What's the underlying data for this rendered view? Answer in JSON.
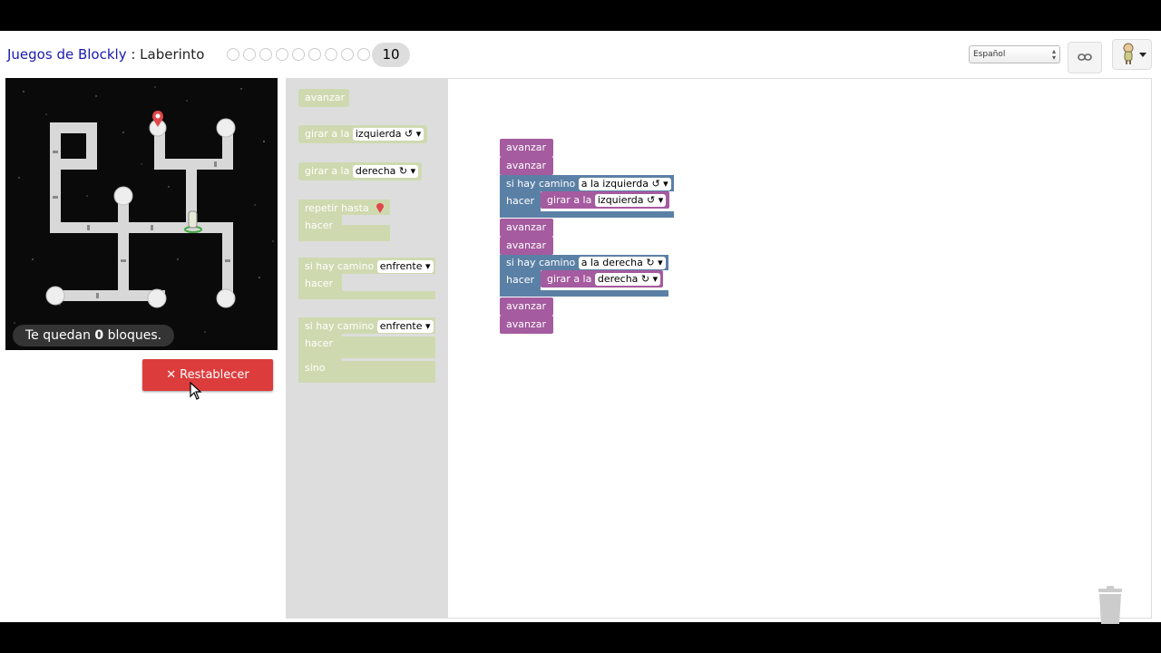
{
  "header": {
    "app_title": "Juegos de Blockly",
    "separator": " : ",
    "game_title": "Laberinto",
    "level_dots": 9,
    "current_level": "10",
    "language": "Español"
  },
  "maze": {
    "remaining_text_pre": "Te quedan ",
    "remaining_count": "0",
    "remaining_text_post": " bloques."
  },
  "reset_button": {
    "icon": "✕",
    "label": "Restablecer"
  },
  "toolbox": {
    "move_forward": "avanzar",
    "turn_left_label": "girar a la",
    "turn_left_value": "izquierda ↺ ▾",
    "turn_right_label": "girar a la",
    "turn_right_value": "derecha ↻ ▾",
    "repeat_label": "repetir hasta",
    "repeat_do": "hacer",
    "if_label": "si hay camino",
    "if_value": "enfrente ▾",
    "if_do": "hacer",
    "ifelse_label": "si hay camino",
    "ifelse_value": "enfrente ▾",
    "ifelse_do": "hacer",
    "ifelse_else": "sino"
  },
  "program": {
    "b1": "avanzar",
    "b2": "avanzar",
    "if1_label": "si hay camino",
    "if1_value": "a la izquierda ↺ ▾",
    "if1_do": "hacer",
    "if1_inner_label": "girar a la",
    "if1_inner_value": "izquierda ↺ ▾",
    "b3": "avanzar",
    "b4": "avanzar",
    "if2_label": "si hay camino",
    "if2_value": "a la derecha ↻ ▾",
    "if2_do": "hacer",
    "if2_inner_label": "girar a la",
    "if2_inner_value": "derecha ↻ ▾",
    "b5": "avanzar",
    "b6": "avanzar"
  },
  "colors": {
    "movement_block": "#a55b9f",
    "logic_block": "#5b80a5",
    "loop_block": "#5ba55b",
    "toolbox_faded_block": "#c8d6a6",
    "reset_red": "#dd3c3c"
  }
}
